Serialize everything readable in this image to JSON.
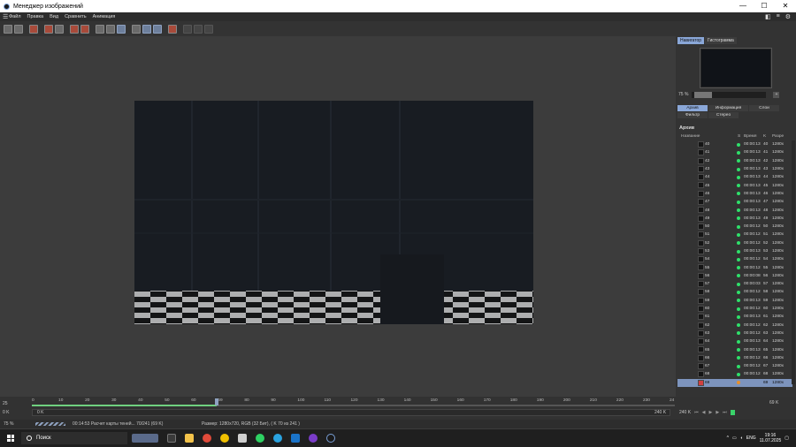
{
  "window": {
    "title": "Менеджер изображений"
  },
  "menu": {
    "items": [
      "Файл",
      "Правка",
      "Вид",
      "Сравнить",
      "Анимация"
    ]
  },
  "right_panel": {
    "tabs": [
      "Навигатор",
      "Гистограмма"
    ],
    "zoom": "75 %",
    "info_tabs_row1": [
      "Архив",
      "Информация",
      "Слои"
    ],
    "info_tabs_row2": [
      "Фильтр",
      "Стерео"
    ],
    "section_title": "Архив",
    "columns": [
      "Название",
      "S",
      "Время",
      "K",
      "Разре"
    ],
    "rows": [
      {
        "name": "40",
        "time": "00:00:13",
        "k": "40",
        "res": "1280x"
      },
      {
        "name": "41",
        "time": "00:00:13",
        "k": "41",
        "res": "1280x"
      },
      {
        "name": "42",
        "time": "00:00:13",
        "k": "42",
        "res": "1280x"
      },
      {
        "name": "43",
        "time": "00:00:13",
        "k": "43",
        "res": "1280x"
      },
      {
        "name": "44",
        "time": "00:00:13",
        "k": "44",
        "res": "1280x"
      },
      {
        "name": "45",
        "time": "00:00:13",
        "k": "45",
        "res": "1280x"
      },
      {
        "name": "46",
        "time": "00:00:13",
        "k": "46",
        "res": "1280x"
      },
      {
        "name": "47",
        "time": "00:00:13",
        "k": "47",
        "res": "1280x"
      },
      {
        "name": "48",
        "time": "00:00:13",
        "k": "48",
        "res": "1280x"
      },
      {
        "name": "49",
        "time": "00:00:13",
        "k": "49",
        "res": "1280x"
      },
      {
        "name": "50",
        "time": "00:00:12",
        "k": "50",
        "res": "1280x"
      },
      {
        "name": "51",
        "time": "00:00:12",
        "k": "51",
        "res": "1280x"
      },
      {
        "name": "52",
        "time": "00:00:12",
        "k": "52",
        "res": "1280x"
      },
      {
        "name": "53",
        "time": "00:00:13",
        "k": "53",
        "res": "1280x"
      },
      {
        "name": "54",
        "time": "00:00:12",
        "k": "54",
        "res": "1280x"
      },
      {
        "name": "55",
        "time": "00:00:12",
        "k": "55",
        "res": "1280x"
      },
      {
        "name": "56",
        "time": "00:00:08",
        "k": "56",
        "res": "1280x"
      },
      {
        "name": "57",
        "time": "00:00:03",
        "k": "57",
        "res": "1280x"
      },
      {
        "name": "58",
        "time": "00:00:12",
        "k": "58",
        "res": "1280x"
      },
      {
        "name": "59",
        "time": "00:00:13",
        "k": "59",
        "res": "1280x"
      },
      {
        "name": "60",
        "time": "00:00:12",
        "k": "60",
        "res": "1280x"
      },
      {
        "name": "61",
        "time": "00:00:13",
        "k": "61",
        "res": "1280x"
      },
      {
        "name": "62",
        "time": "00:00:12",
        "k": "62",
        "res": "1280x"
      },
      {
        "name": "63",
        "time": "00:00:12",
        "k": "63",
        "res": "1280x"
      },
      {
        "name": "64",
        "time": "00:00:13",
        "k": "64",
        "res": "1280x"
      },
      {
        "name": "65",
        "time": "00:00:13",
        "k": "65",
        "res": "1280x"
      },
      {
        "name": "66",
        "time": "00:00:12",
        "k": "66",
        "res": "1280x"
      },
      {
        "name": "67",
        "time": "00:00:12",
        "k": "67",
        "res": "1280x"
      },
      {
        "name": "68",
        "time": "00:00:12",
        "k": "68",
        "res": "1280x"
      }
    ],
    "selected_row": {
      "name": "69",
      "time": "",
      "k": "69",
      "res": "1280x"
    }
  },
  "timeline": {
    "fps": "25",
    "ticks": [
      "0",
      "10",
      "20",
      "30",
      "40",
      "50",
      "60",
      "69",
      "80",
      "90",
      "100",
      "110",
      "120",
      "130",
      "140",
      "150",
      "160",
      "170",
      "180",
      "190",
      "200",
      "210",
      "220",
      "230",
      "24"
    ],
    "current": "69 K",
    "track_left": "0 K",
    "track_start": "0 K",
    "track_end": "240 K",
    "track_right": "240 K",
    "progress_fraction": 0.287
  },
  "status": {
    "zoom": "75 %",
    "message": "00:14:53 Расчет карты теней... 70/241 (69 K)",
    "info": "Размер: 1280x720, RGB (32 Бит), ( K 70 из 241 )"
  },
  "taskbar": {
    "search": "Поиск",
    "lang": "ENG",
    "time": "19:16",
    "date": "11.07.2025"
  }
}
